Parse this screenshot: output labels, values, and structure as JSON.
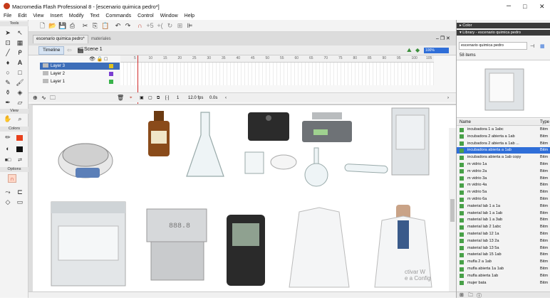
{
  "window": {
    "title": "Macromedia Flash Professional 8 - [escenario quimica pedro*]",
    "minimize": "–",
    "maximize": "□",
    "close": "✕"
  },
  "menu": [
    "File",
    "Edit",
    "View",
    "Insert",
    "Modify",
    "Text",
    "Commands",
    "Control",
    "Window",
    "Help"
  ],
  "tools": {
    "header": "Tools",
    "view_label": "View",
    "colors_label": "Colors",
    "options_label": "Options"
  },
  "doc_tabs": {
    "active": "escenario quimica pedro*",
    "inactive": "materiales",
    "controls": "– ❐ ✕"
  },
  "timeline": {
    "button": "Timeline",
    "scene": "Scene 1",
    "zoom": "100%",
    "layers": [
      {
        "name": "Layer 3",
        "color": "#e0c21f"
      },
      {
        "name": "Layer 2",
        "color": "#7b3fd1"
      },
      {
        "name": "Layer 1",
        "color": "#38b24a"
      }
    ],
    "ruler": [
      "5",
      "10",
      "15",
      "20",
      "25",
      "30",
      "35",
      "40",
      "45",
      "50",
      "55",
      "60",
      "65",
      "70",
      "75",
      "80",
      "85",
      "90",
      "95",
      "100",
      "105"
    ],
    "frame_num": "1",
    "fps": "12.0 fps",
    "time": "0.0s"
  },
  "panels": {
    "color": "▸ Color",
    "library": "▾ Library - escenario quimica pedro"
  },
  "library": {
    "selected_doc": "escenario quimica pedro",
    "count": "58 items",
    "col_name": "Name",
    "col_type": "Type",
    "items": [
      {
        "name": "incubadora 1 a 1abc",
        "type": "Bitm"
      },
      {
        "name": "incubadora 2 abierta a 1ab",
        "type": "Bitm"
      },
      {
        "name": "incubadora 2 abierta a 1ab ...",
        "type": "Bitm"
      },
      {
        "name": "incubadora abierta a 1ab",
        "type": "Bitm",
        "selected": true
      },
      {
        "name": "incubadora abierta a 1ab copy",
        "type": "Bitm"
      },
      {
        "name": "m vidrio 1a",
        "type": "Bitm"
      },
      {
        "name": "m vidrio 2a",
        "type": "Bitm"
      },
      {
        "name": "m vidrio 3a",
        "type": "Bitm"
      },
      {
        "name": "m vidrio 4a",
        "type": "Bitm"
      },
      {
        "name": "m vidrio 5a",
        "type": "Bitm"
      },
      {
        "name": "m vidrio 6a",
        "type": "Bitm"
      },
      {
        "name": "material lab 1 a 1a",
        "type": "Bitm"
      },
      {
        "name": "material lab 1 a 1ab",
        "type": "Bitm"
      },
      {
        "name": "material lab 1 a 3ab",
        "type": "Bitm"
      },
      {
        "name": "material lab 2 1abc",
        "type": "Bitm"
      },
      {
        "name": "material lab 12 1a",
        "type": "Bitm"
      },
      {
        "name": "material lab 13 2a",
        "type": "Bitm"
      },
      {
        "name": "material lab 13 5a",
        "type": "Bitm"
      },
      {
        "name": "material lab 15 1ab",
        "type": "Bitm"
      },
      {
        "name": "mufla 2 a 1ab",
        "type": "Bitm"
      },
      {
        "name": "mufla abierta 1a 1ab",
        "type": "Bitm"
      },
      {
        "name": "mufla abierta 1ab",
        "type": "Bitm"
      },
      {
        "name": "mujer bata",
        "type": "Bitm"
      }
    ]
  },
  "watermark": {
    "line1": "ctivar W",
    "line2": "e a Config"
  },
  "stage_label_display": "888.8",
  "accent": "#2f6ed8"
}
